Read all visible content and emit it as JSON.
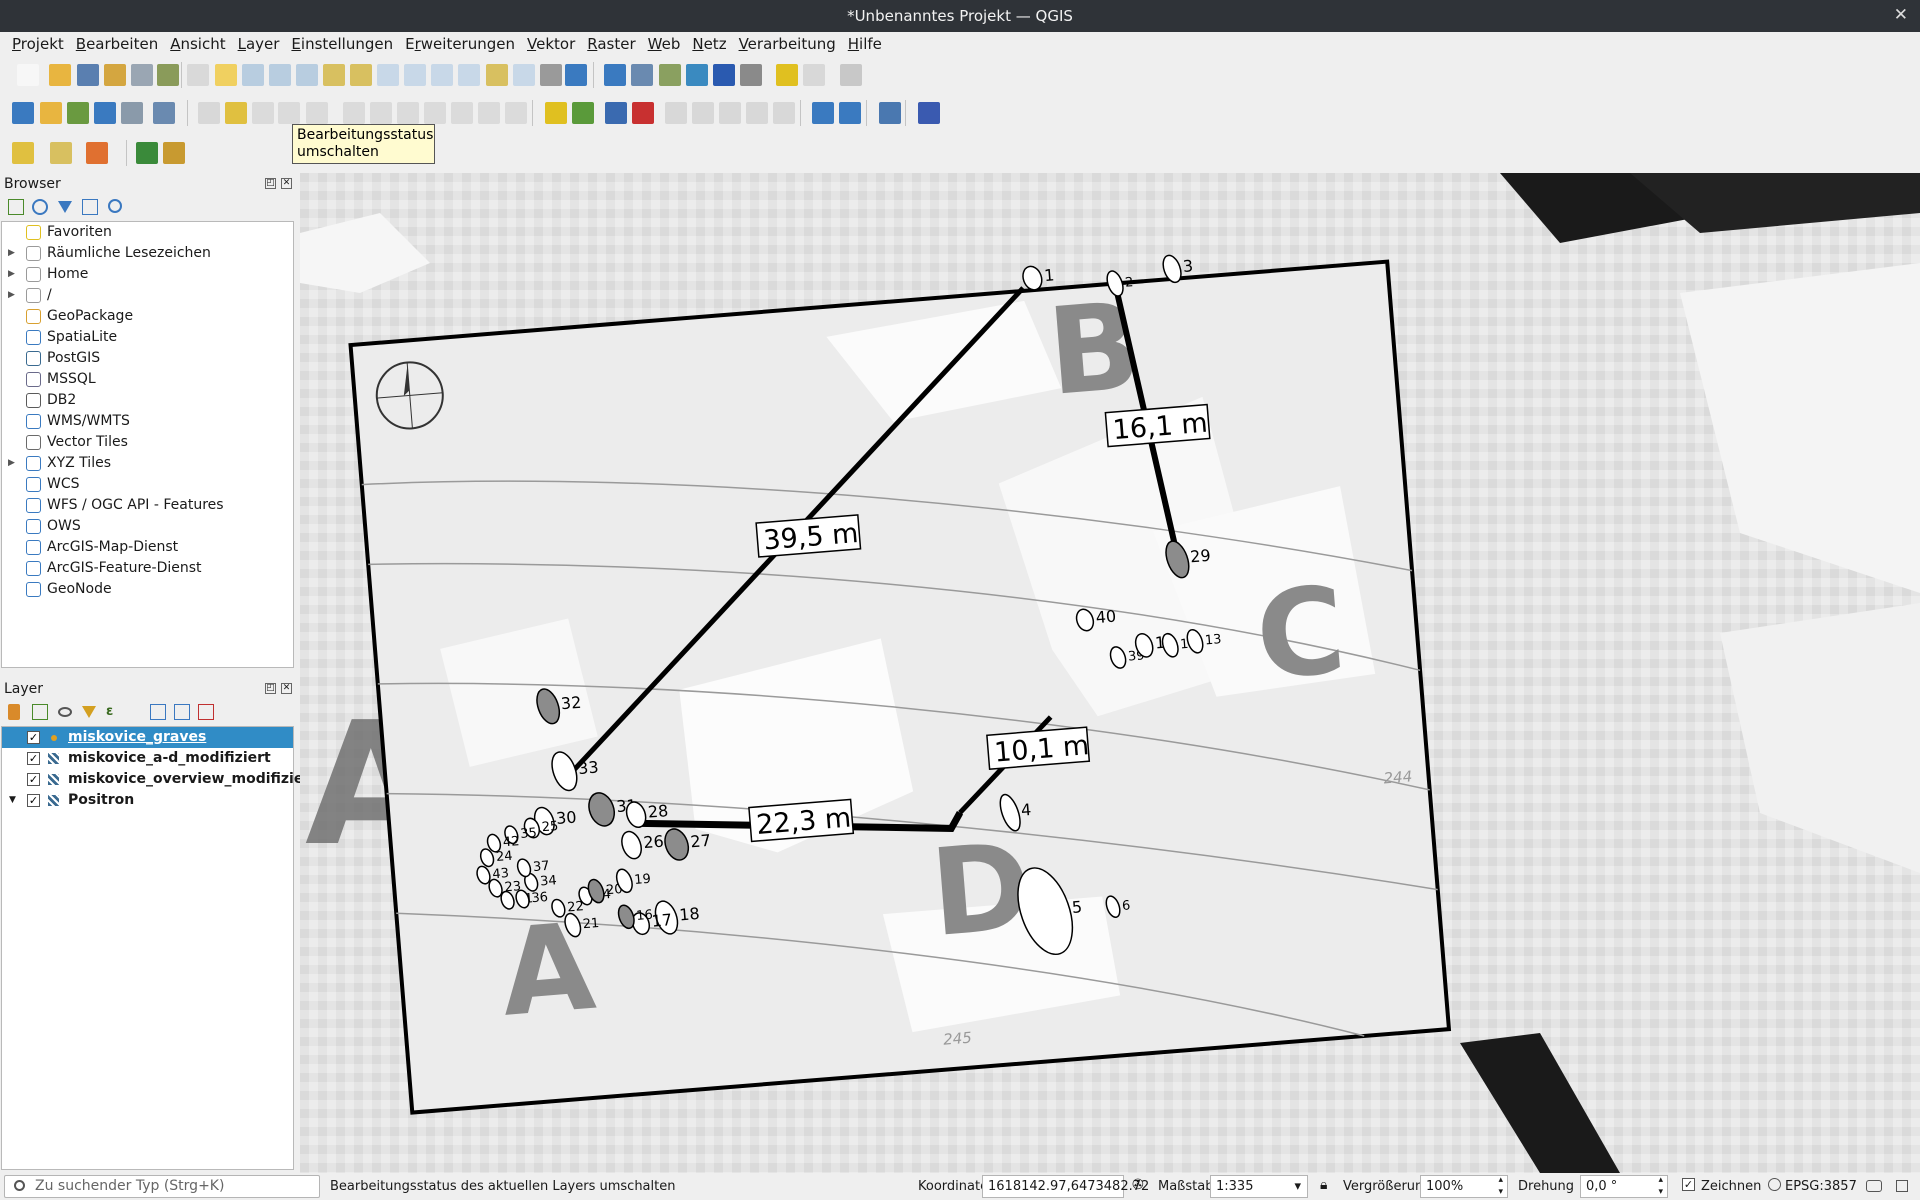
{
  "window": {
    "title": "*Unbenanntes Projekt — QGIS",
    "close_glyph": "✕"
  },
  "menu": [
    {
      "pre": "",
      "ul": "P",
      "post": "rojekt"
    },
    {
      "pre": "",
      "ul": "B",
      "post": "earbeiten"
    },
    {
      "pre": "",
      "ul": "A",
      "post": "nsicht"
    },
    {
      "pre": "",
      "ul": "L",
      "post": "ayer"
    },
    {
      "pre": "",
      "ul": "E",
      "post": "instellungen"
    },
    {
      "pre": "E",
      "ul": "r",
      "post": "weiterungen"
    },
    {
      "pre": "",
      "ul": "V",
      "post": "ektor"
    },
    {
      "pre": "",
      "ul": "R",
      "post": "aster"
    },
    {
      "pre": "",
      "ul": "W",
      "post": "eb"
    },
    {
      "pre": "",
      "ul": "N",
      "post": "etz"
    },
    {
      "pre": "",
      "ul": "V",
      "post": "erarbeitung"
    },
    {
      "pre": "",
      "ul": "H",
      "post": "ilfe"
    }
  ],
  "tooltip": {
    "line1": "Bearbeitungsstatus",
    "line2": "umschalten"
  },
  "browser": {
    "title": "Browser",
    "items": [
      {
        "label": "Favoriten",
        "icon": "star-icon",
        "expandable": false
      },
      {
        "label": "Räumliche Lesezeichen",
        "icon": "bookmark-icon",
        "expandable": true
      },
      {
        "label": "Home",
        "icon": "home-folder-icon",
        "expandable": true
      },
      {
        "label": "/",
        "icon": "folder-icon",
        "expandable": true
      },
      {
        "label": "GeoPackage",
        "icon": "geopackage-icon",
        "expandable": false
      },
      {
        "label": "SpatiaLite",
        "icon": "spatialite-icon",
        "expandable": false
      },
      {
        "label": "PostGIS",
        "icon": "postgis-icon",
        "expandable": false
      },
      {
        "label": "MSSQL",
        "icon": "mssql-icon",
        "expandable": false
      },
      {
        "label": "DB2",
        "icon": "db2-icon",
        "expandable": false
      },
      {
        "label": "WMS/WMTS",
        "icon": "wms-icon",
        "expandable": false
      },
      {
        "label": "Vector Tiles",
        "icon": "vector-tiles-icon",
        "expandable": false
      },
      {
        "label": "XYZ Tiles",
        "icon": "xyz-tiles-icon",
        "expandable": true
      },
      {
        "label": "WCS",
        "icon": "wcs-icon",
        "expandable": false
      },
      {
        "label": "WFS / OGC API - Features",
        "icon": "wfs-icon",
        "expandable": false
      },
      {
        "label": "OWS",
        "icon": "ows-icon",
        "expandable": false
      },
      {
        "label": "ArcGIS-Map-Dienst",
        "icon": "arcgis-map-icon",
        "expandable": false
      },
      {
        "label": "ArcGIS-Feature-Dienst",
        "icon": "arcgis-feature-icon",
        "expandable": false
      },
      {
        "label": "GeoNode",
        "icon": "geonode-icon",
        "expandable": false
      }
    ]
  },
  "layers": {
    "title": "Layer",
    "items": [
      {
        "label": "miskovice_graves",
        "selected": true,
        "checked": true,
        "type": "point-layer-icon",
        "expandable": false
      },
      {
        "label": "miskovice_a-d_modifiziert",
        "selected": false,
        "checked": true,
        "type": "raster-layer-icon",
        "expandable": false
      },
      {
        "label": "miskovice_overview_modifiziert",
        "selected": false,
        "checked": true,
        "type": "raster-layer-icon",
        "expandable": false
      },
      {
        "label": "Positron",
        "selected": false,
        "checked": true,
        "type": "raster-layer-icon",
        "expandable": true
      }
    ]
  },
  "map": {
    "distance_labels": [
      "39,5 m",
      "16,1 m",
      "10,1 m",
      "22,3 m"
    ],
    "section_letters": [
      "A",
      "B",
      "C",
      "D",
      "A"
    ],
    "grave_numbers": [
      "1",
      "2",
      "3",
      "29",
      "40",
      "39",
      "15",
      "14",
      "13",
      "32",
      "33",
      "31",
      "30",
      "28",
      "25",
      "35",
      "42",
      "24",
      "43",
      "23",
      "41",
      "36",
      "34",
      "37",
      "22",
      "21",
      "44",
      "20",
      "19",
      "26",
      "27",
      "18",
      "17",
      "16",
      "4",
      "5",
      "6"
    ],
    "contours": [
      "244",
      "245"
    ]
  },
  "status": {
    "search_placeholder": "Zu suchender Typ (Strg+K)",
    "message": "Bearbeitungsstatus des aktuellen Layers umschalten",
    "coord_label": "Koordinate",
    "coord_value": "1618142.97,6473482.72",
    "scale_label": "Maßstab",
    "scale_value": "1:335",
    "magnifier_label": "Vergrößerung",
    "magnifier_value": "100%",
    "rotation_label": "Drehung",
    "rotation_value": "0,0 °",
    "render_label": "Zeichnen",
    "crs": "EPSG:3857"
  }
}
